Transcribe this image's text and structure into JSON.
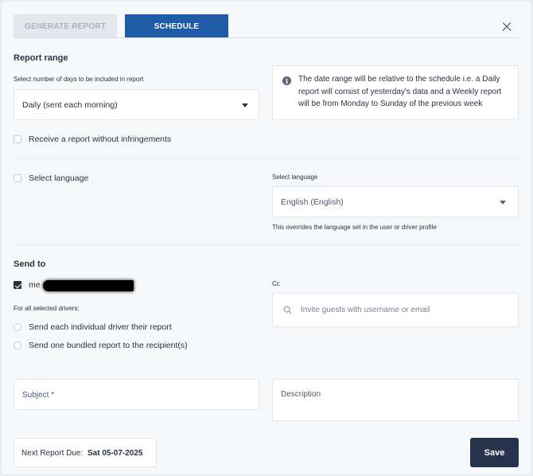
{
  "tabs": [
    {
      "label": "GENERATE REPORT"
    },
    {
      "label": "SCHEDULE"
    }
  ],
  "report_range": {
    "title": "Report range",
    "days_label": "Select number of days to be included in report",
    "days_value": "Daily (sent each morning)",
    "info_text": "The date range will be relative to the schedule i.e. a Daily report will consist of yesterday's data and a Weekly report will be from Monday to Sunday of the previous week"
  },
  "infringements": {
    "label": "Receive a report without infringements"
  },
  "language": {
    "checkbox_label": "Select language",
    "select_label": "Select language",
    "select_value": "English (English)",
    "hint": "This overrides the language set in the user or driver profile"
  },
  "send_to": {
    "title": "Send to",
    "me_label": "me",
    "drivers_label": "For all selected drivers:",
    "option_individual": "Send each individual driver their report",
    "option_bundled": "Send one bundled report to the recipient(s)",
    "cc_label": "Cc",
    "cc_placeholder": "Invite guests with username or email"
  },
  "subject": {
    "placeholder": "Subject *"
  },
  "description": {
    "placeholder": "Description"
  },
  "footer": {
    "next_due_label": "Next Report Due:",
    "next_due_value": "Sat 05-07-2025",
    "save_label": "Save"
  }
}
